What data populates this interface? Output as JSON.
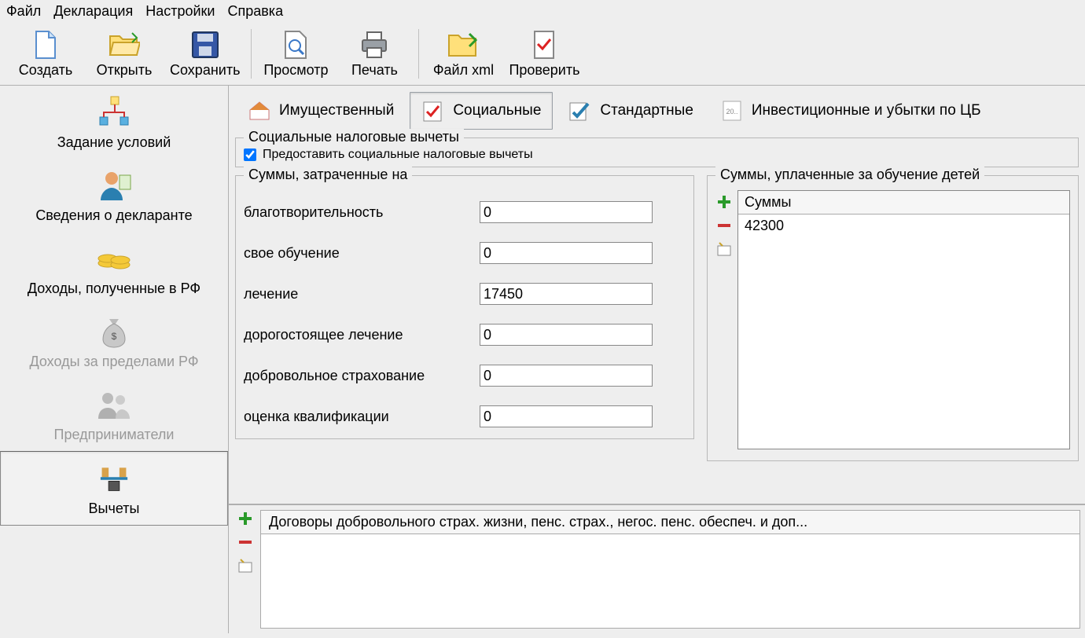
{
  "menu": {
    "items": [
      "Файл",
      "Декларация",
      "Настройки",
      "Справка"
    ]
  },
  "toolbar": {
    "create": "Создать",
    "open": "Открыть",
    "save": "Сохранить",
    "preview": "Просмотр",
    "print": "Печать",
    "xml": "Файл xml",
    "check": "Проверить"
  },
  "sidebar": {
    "conditions": "Задание условий",
    "declarant": "Сведения о декларанте",
    "income_rf": "Доходы, полученные в РФ",
    "income_abroad": "Доходы за пределами РФ",
    "entrepreneurs": "Предприниматели",
    "deductions": "Вычеты"
  },
  "tabs": {
    "property": "Имущественный",
    "social": "Социальные",
    "standard": "Стандартные",
    "investment": "Инвестиционные и убытки по ЦБ"
  },
  "social": {
    "group_title": "Социальные налоговые вычеты",
    "provide_label": "Предоставить социальные налоговые вычеты",
    "provide_checked": true,
    "spent_title": "Суммы, затраченные на",
    "fields": {
      "charity": {
        "label": "благотворительность",
        "value": "0"
      },
      "own_education": {
        "label": "свое обучение",
        "value": "0"
      },
      "treatment": {
        "label": "лечение",
        "value": "17450"
      },
      "expensive_treatment": {
        "label": "дорогостоящее лечение",
        "value": "0"
      },
      "insurance": {
        "label": "добровольное страхование",
        "value": "0"
      },
      "qualification": {
        "label": "оценка квалификации",
        "value": "0"
      }
    },
    "education_title": "Суммы, уплаченные за обучение детей",
    "education_header": "Суммы",
    "education_rows": [
      "42300"
    ],
    "contracts_title": "Договоры добровольного страх. жизни, пенс. страх., негос. пенс. обеспеч. и доп..."
  }
}
